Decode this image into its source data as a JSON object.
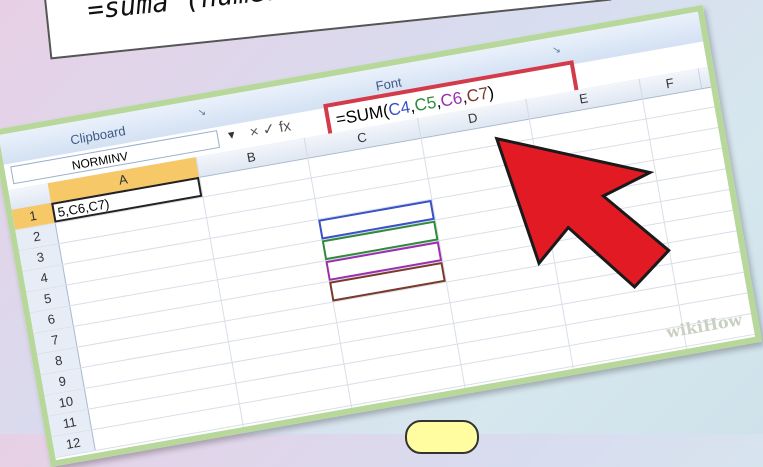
{
  "note": {
    "text": "=suma (numero1 nu"
  },
  "ribbon": {
    "clipboard": "Clipboard",
    "font": "Font",
    "launcher": "↘"
  },
  "formula_bar": {
    "namebox": "NORMINV",
    "icons": "× ✓ fx",
    "formula_prefix": "=SUM(",
    "ref1": "C4",
    "ref2": "C5",
    "ref3": "C6",
    "ref4": "C7",
    "formula_suffix": ")"
  },
  "columns": [
    "A",
    "B",
    "C",
    "D",
    "E",
    "F"
  ],
  "rows": [
    "1",
    "2",
    "3",
    "4",
    "5",
    "6",
    "7",
    "8",
    "9",
    "10",
    "11",
    "12"
  ],
  "cellA1": "5,C6,C7)",
  "watermark": "wikiHow",
  "colors": {
    "red_arrow": "#e21a24",
    "border_green": "#b7d89a"
  }
}
